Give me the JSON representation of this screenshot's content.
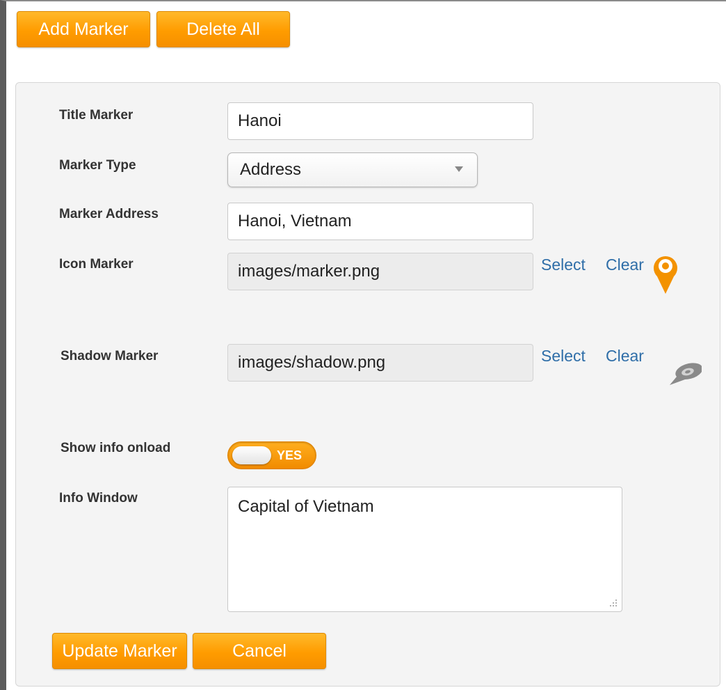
{
  "toolbar": {
    "add_label": "Add Marker",
    "delete_label": "Delete All"
  },
  "form": {
    "title": {
      "label": "Title Marker",
      "value": "Hanoi"
    },
    "type": {
      "label": "Marker Type",
      "value": "Address"
    },
    "address": {
      "label": "Marker Address",
      "value": "Hanoi, Vietnam"
    },
    "icon": {
      "label": "Icon Marker",
      "value": "images/marker.png",
      "select": "Select",
      "clear": "Clear"
    },
    "shadow": {
      "label": "Shadow Marker",
      "value": "images/shadow.png",
      "select": "Select",
      "clear": "Clear"
    },
    "show_info": {
      "label": "Show info onload",
      "toggle": "YES"
    },
    "info": {
      "label": "Info Window",
      "value": "Capital of Vietnam"
    }
  },
  "actions": {
    "update_label": "Update Marker",
    "cancel_label": "Cancel"
  },
  "colors": {
    "accent": "#ff9c00",
    "link": "#2f6ea8"
  }
}
